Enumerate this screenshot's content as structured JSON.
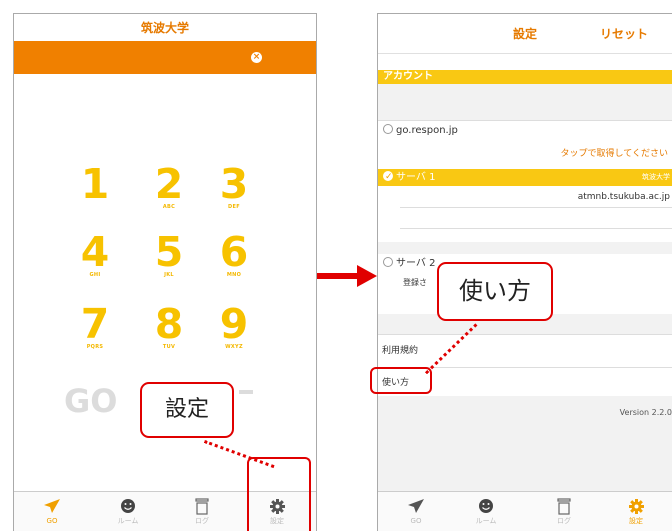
{
  "left_screen": {
    "title": "筑波大学",
    "clear_icon": "x-circle-icon",
    "keypad": [
      {
        "num": "1",
        "sub": ""
      },
      {
        "num": "2",
        "sub": "ABC"
      },
      {
        "num": "3",
        "sub": "DEF"
      },
      {
        "num": "4",
        "sub": "GHI"
      },
      {
        "num": "5",
        "sub": "JKL"
      },
      {
        "num": "6",
        "sub": "MNO"
      },
      {
        "num": "7",
        "sub": "PQRS"
      },
      {
        "num": "8",
        "sub": "TUV"
      },
      {
        "num": "9",
        "sub": "WXYZ"
      }
    ],
    "go_label": "GO",
    "tabs": [
      {
        "label": "GO",
        "icon": "paper-plane-icon",
        "active": true
      },
      {
        "label": "ルーム",
        "icon": "smiley-icon",
        "active": false
      },
      {
        "label": "ログ",
        "icon": "trash-icon",
        "active": false
      },
      {
        "label": "設定",
        "icon": "gear-icon",
        "active": false
      }
    ]
  },
  "right_screen": {
    "nav_title": "設定",
    "reset_label": "リセット",
    "account_header": "アカウント",
    "option_gorespon": "go.respon.jp",
    "tap_hint": "タップで取得してください",
    "server1_label": "サーバ 1",
    "server1_name": "筑波大学",
    "server1_host": "atmnb.tsukuba.ac.jp",
    "server2_label": "サーバ 2",
    "register_label": "登録さ",
    "terms_label": "利用規約",
    "usage_label": "使い方",
    "version": "Version 2.2.0",
    "tabs": [
      {
        "label": "GO",
        "icon": "paper-plane-icon",
        "active": false
      },
      {
        "label": "ルーム",
        "icon": "smiley-icon",
        "active": false
      },
      {
        "label": "ログ",
        "icon": "trash-icon",
        "active": false
      },
      {
        "label": "設定",
        "icon": "gear-icon",
        "active": true
      }
    ]
  },
  "annotations": {
    "callout_settings": "設定",
    "callout_usage": "使い方"
  },
  "colors": {
    "accent_orange": "#f08000",
    "accent_yellow": "#f9c813",
    "annotation_red": "#e00000"
  }
}
